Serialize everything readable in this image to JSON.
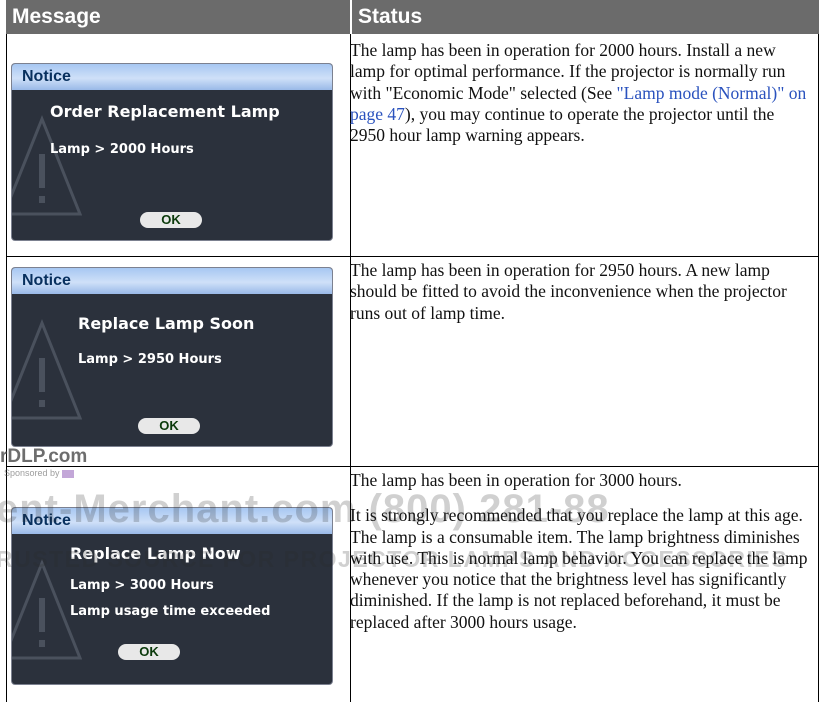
{
  "header": {
    "message_col": "Message",
    "status_col": "Status"
  },
  "rows": [
    {
      "notice": {
        "bar_title": "Notice",
        "title": "Order Replacement Lamp",
        "lines": [
          "Lamp > 2000 Hours"
        ],
        "ok_label": "OK"
      },
      "status_before_link": "The lamp has been in operation for 2000 hours. Install a new lamp for optimal performance. If the projector is normally run with \"Economic Mode\" selected (See ",
      "status_link": "\"Lamp mode (Normal)\" on page 47",
      "status_after_link": "), you may continue to operate the projector until the 2950 hour lamp warning appears."
    },
    {
      "notice": {
        "bar_title": "Notice",
        "title": "Replace Lamp Soon",
        "lines": [
          "Lamp > 2950 Hours"
        ],
        "ok_label": "OK"
      },
      "status_text": "The lamp has been in operation for 2950 hours. A new lamp should be fitted to avoid the inconvenience when the projector runs out of lamp time."
    },
    {
      "notice": {
        "bar_title": "Notice",
        "title": "Replace Lamp Now",
        "lines": [
          "Lamp > 3000 Hours",
          "Lamp usage time exceeded"
        ],
        "ok_label": "OK"
      },
      "status_p1": "The lamp has been in operation for 3000 hours.",
      "status_p2": "It is strongly recommended that you replace the lamp at this age. The lamp is a consumable item. The lamp brightness diminishes with use. This is normal lamp behavior. You can replace the lamp whenever you notice that the brightness level has significantly diminished. If the lamp is not replaced beforehand, it must be replaced after 3000 hours usage."
    }
  ],
  "watermark": {
    "dlp": "rDLP.com",
    "sponsored": "Sponsored by",
    "merchant": "ent-Merchant.com (800) 281-88",
    "trusted": "RUSTED SOURCE FOR PROJECTOR LAMPS AND ACCESSORIES"
  },
  "colors": {
    "header_bg": "#6b6b6b",
    "notice_body": "#2b313c",
    "link": "#2a52be"
  }
}
